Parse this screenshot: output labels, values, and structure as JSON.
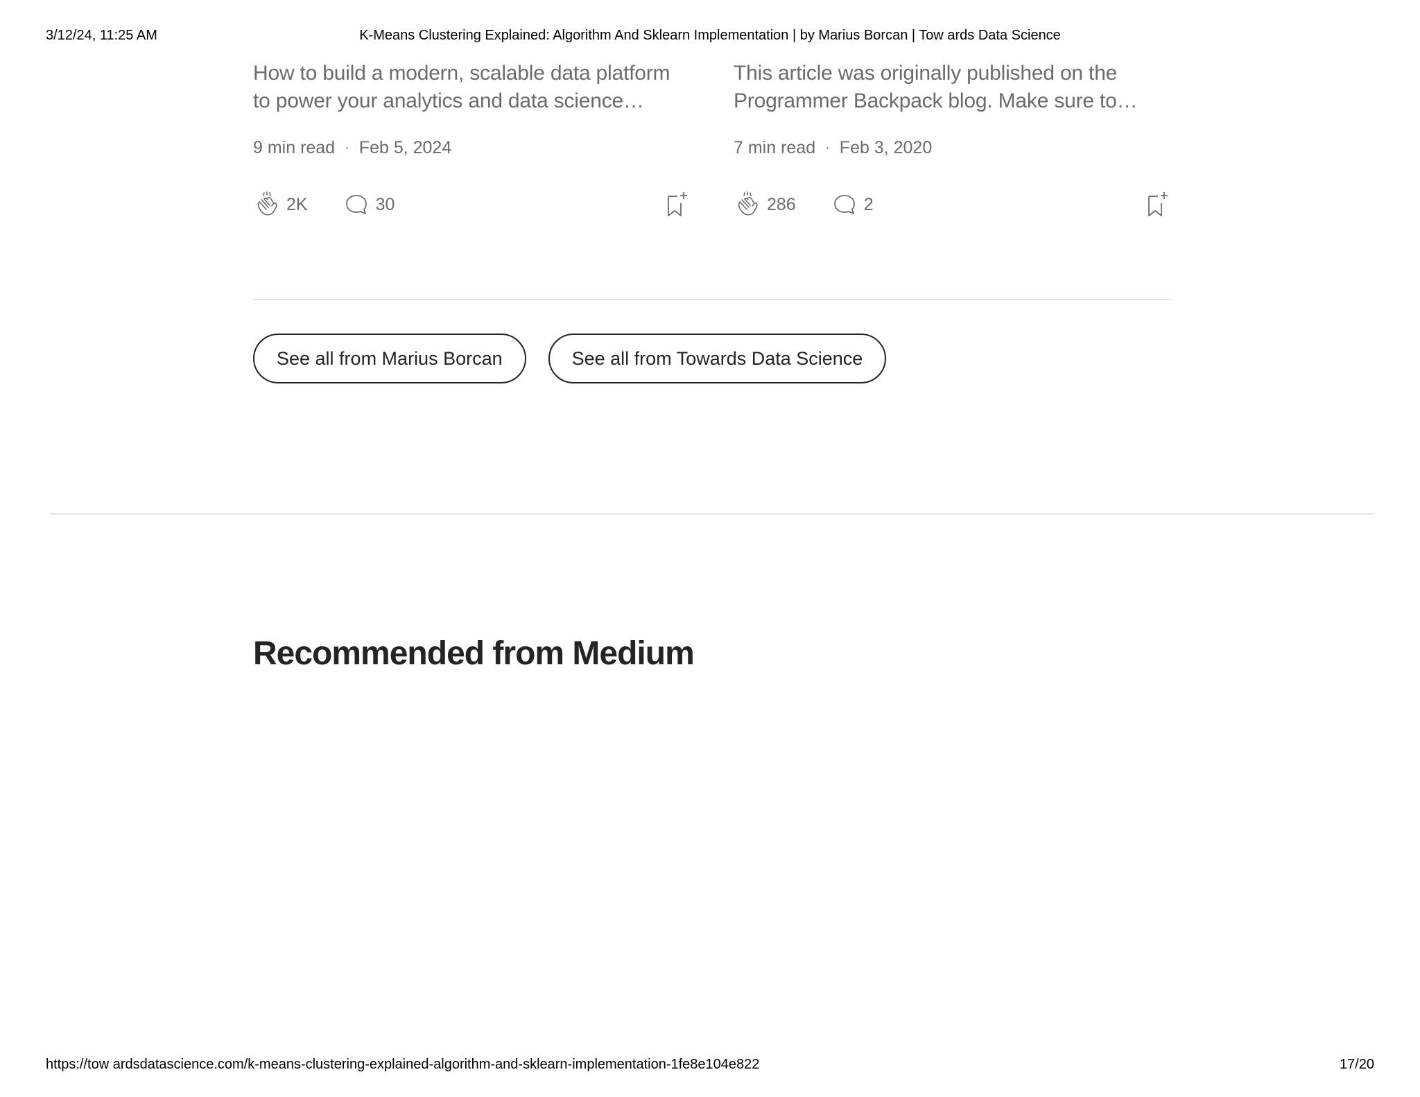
{
  "print_header": {
    "datetime": "3/12/24, 11:25 AM",
    "title": "K-Means Clustering Explained: Algorithm And Sklearn Implementation | by Marius Borcan | Tow ards Data Science"
  },
  "cards": [
    {
      "description": "How to build a modern, scalable data platform to power your analytics and data science…",
      "read_time": "9 min read",
      "date": "Feb 5, 2024",
      "claps": "2K",
      "responses": "30"
    },
    {
      "description": "This article was originally published on the Programmer Backpack blog. Make sure to…",
      "read_time": "7 min read",
      "date": "Feb 3, 2020",
      "claps": "286",
      "responses": "2"
    }
  ],
  "meta_separator": "·",
  "buttons": {
    "author": "See all from Marius Borcan",
    "publication": "See all from Towards Data Science"
  },
  "recommended_title": "Recommended from Medium",
  "print_footer": {
    "url": "https://tow ardsdatascience.com/k-means-clustering-explained-algorithm-and-sklearn-implementation-1fe8e104e822",
    "page": "17/20"
  },
  "icons": {
    "clap": "clap-icon",
    "response": "response-icon",
    "bookmark": "bookmark-add-icon"
  },
  "colors": {
    "text": "#242424",
    "muted": "#6b6b6b",
    "divider": "#e6e6e6"
  }
}
